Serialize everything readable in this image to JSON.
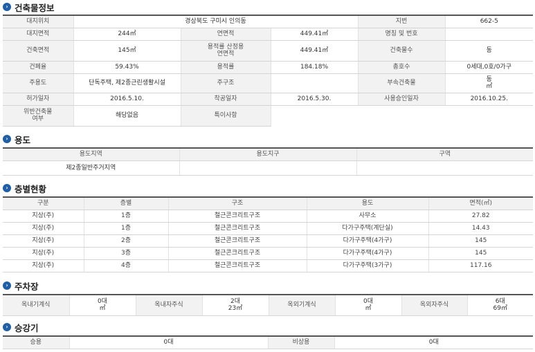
{
  "sections": {
    "building": {
      "title": "건축물정보"
    },
    "usage": {
      "title": "용도"
    },
    "floors": {
      "title": "층별현황"
    },
    "parking": {
      "title": "주차장"
    },
    "elevator": {
      "title": "승강기"
    }
  },
  "building_info": {
    "address_label": "대지위치",
    "address_value": "경상북도 구미시 인의동",
    "lot_label": "지번",
    "lot_value": "662-5",
    "site_area_label": "대지면적",
    "site_area_value": "244㎡",
    "total_floor_area_label": "연면적",
    "total_floor_area_value": "449.41㎡",
    "name_label": "명칭 및 번호",
    "name_value": "",
    "building_area_label": "건축면적",
    "building_area_value": "145㎡",
    "calc_area_label_1": "용적률 산정용",
    "calc_area_label_2": "연면적",
    "calc_area_value": "449.41㎡",
    "floors_count_label": "건축물수",
    "floors_count_value": "동",
    "coverage_label": "건폐율",
    "coverage_value": "59.43%",
    "far_label": "용적률",
    "far_value": "184.18%",
    "households_label": "총호수",
    "households_value": "0세대,0호/0가구",
    "main_use_label": "주용도",
    "main_use_value": "단독주택, 제2종근린생활시설",
    "structure_label": "주구조",
    "structure_value": "",
    "annex_label": "부속건축물",
    "annex_value_1": "동",
    "annex_value_2": "㎡",
    "permit_label": "허가일자",
    "permit_value": "2016.5.10.",
    "start_label": "착공일자",
    "start_value": "2016.5.30.",
    "approval_label": "사용승인일자",
    "approval_value": "2016.10.25.",
    "violation_label_1": "위반건축물",
    "violation_label_2": "여부",
    "violation_value": "해당없음",
    "remarks_label": "특이사항",
    "remarks_value": ""
  },
  "usage_table": {
    "headers": [
      "용도지역",
      "용도지구",
      "구역"
    ],
    "row": [
      "제2종일반주거지역",
      "",
      ""
    ]
  },
  "floors_table": {
    "headers": [
      "구분",
      "층별",
      "구조",
      "용도",
      "면적(㎡)"
    ],
    "rows": [
      [
        "지상(주)",
        "1층",
        "철근콘크리트구조",
        "사무소",
        "27.82"
      ],
      [
        "지상(주)",
        "1층",
        "철근콘크리트구조",
        "다가구주택(계단실)",
        "14.43"
      ],
      [
        "지상(주)",
        "2층",
        "철근콘크리트구조",
        "다가구주택(4가구)",
        "145"
      ],
      [
        "지상(주)",
        "3층",
        "철근콘크리트구조",
        "다가구주택(4가구)",
        "145"
      ],
      [
        "지상(주)",
        "4층",
        "철근콘크리트구조",
        "다가구주택(3가구)",
        "117.16"
      ]
    ]
  },
  "parking_table": {
    "indoor_mech_label": "옥내기계식",
    "indoor_mech_count": "0대",
    "indoor_mech_area": "㎡",
    "indoor_self_label": "옥내자주식",
    "indoor_self_count": "2대",
    "indoor_self_area": "23㎡",
    "outdoor_mech_label": "옥외기계식",
    "outdoor_mech_count": "0대",
    "outdoor_mech_area": "㎡",
    "outdoor_self_label": "옥외자주식",
    "outdoor_self_count": "6대",
    "outdoor_self_area": "69㎡"
  },
  "elevator_table": {
    "passenger_label": "승용",
    "passenger_value": "0대",
    "emergency_label": "비상용",
    "emergency_value": "0대"
  },
  "colors": {
    "bullet": "#1f5fa8",
    "label_bg": "#f2f2f2",
    "header_line": "#555555"
  },
  "icons": {
    "section_bullet": "chevron-right-circle-icon"
  }
}
